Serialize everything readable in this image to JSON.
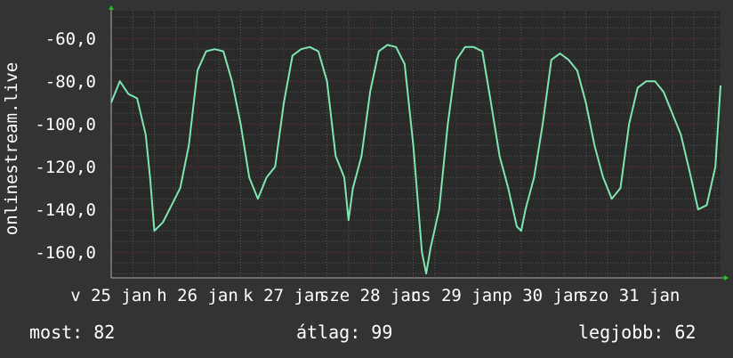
{
  "colors": {
    "background": "#333333",
    "plot_background": "#2a2a2a",
    "grid_major": "#6b2b2b",
    "grid_minor": "#555555",
    "series": "#7ee6b0",
    "axis_arrow": "#22c022",
    "text": "#ffffff"
  },
  "stats": {
    "current": "most: 82",
    "average": "átlag: 99",
    "best": "legjobb: 62"
  },
  "chart_data": {
    "type": "line",
    "ylabel": "onlinestream.live",
    "ylim": [
      -172,
      -47
    ],
    "y_ticks": [
      -60,
      -80,
      -100,
      -120,
      -140,
      -160
    ],
    "y_tick_labels": [
      "-60,0",
      "-80,0",
      "-100,0",
      "-120,0",
      "-140,0",
      "-160,0"
    ],
    "xlim": [
      0,
      7.06
    ],
    "x_ticks": [
      0,
      1,
      2,
      3,
      4,
      5,
      6
    ],
    "x_tick_labels": [
      "v 25 jan",
      "h 26 jan",
      "k 27 jan",
      "sze 28 jan",
      "cs 29 jan",
      "p 30 jan",
      "szo 31 jan"
    ],
    "grid": true,
    "series": [
      {
        "x": [
          0,
          0.1,
          0.2,
          0.3,
          0.4,
          0.45,
          0.5,
          0.6,
          0.7,
          0.8,
          0.9,
          1.0,
          1.1,
          1.2,
          1.3,
          1.4,
          1.5,
          1.6,
          1.7,
          1.75,
          1.8,
          1.9,
          2.0,
          2.1,
          2.2,
          2.3,
          2.4,
          2.5,
          2.6,
          2.7,
          2.75,
          2.8,
          2.9,
          3.0,
          3.1,
          3.2,
          3.3,
          3.4,
          3.5,
          3.6,
          3.65,
          3.7,
          3.8,
          3.9,
          4.0,
          4.1,
          4.2,
          4.3,
          4.4,
          4.5,
          4.6,
          4.7,
          4.75,
          4.8,
          4.9,
          5.0,
          5.1,
          5.2,
          5.3,
          5.4,
          5.5,
          5.6,
          5.7,
          5.75,
          5.8,
          5.9,
          6.0,
          6.1,
          6.2,
          6.3,
          6.4,
          6.5,
          6.6,
          6.7,
          6.8,
          6.9,
          7.0,
          7.06
        ],
        "y": [
          -90,
          -80,
          -86,
          -88,
          -105,
          -125,
          -150,
          -146,
          -138,
          -130,
          -110,
          -75,
          -66,
          -65,
          -66,
          -80,
          -100,
          -125,
          -135,
          -130,
          -125,
          -120,
          -90,
          -68,
          -65,
          -64,
          -66,
          -80,
          -115,
          -125,
          -145,
          -130,
          -115,
          -85,
          -66,
          -63,
          -64,
          -72,
          -110,
          -160,
          -170,
          -158,
          -140,
          -100,
          -70,
          -64,
          -64,
          -66,
          -90,
          -115,
          -130,
          -148,
          -150,
          -140,
          -125,
          -100,
          -70,
          -67,
          -70,
          -75,
          -90,
          -110,
          -125,
          -130,
          -135,
          -130,
          -100,
          -83,
          -80,
          -80,
          -85,
          -95,
          -105,
          -122,
          -140,
          -138,
          -120,
          -82
        ]
      }
    ]
  }
}
